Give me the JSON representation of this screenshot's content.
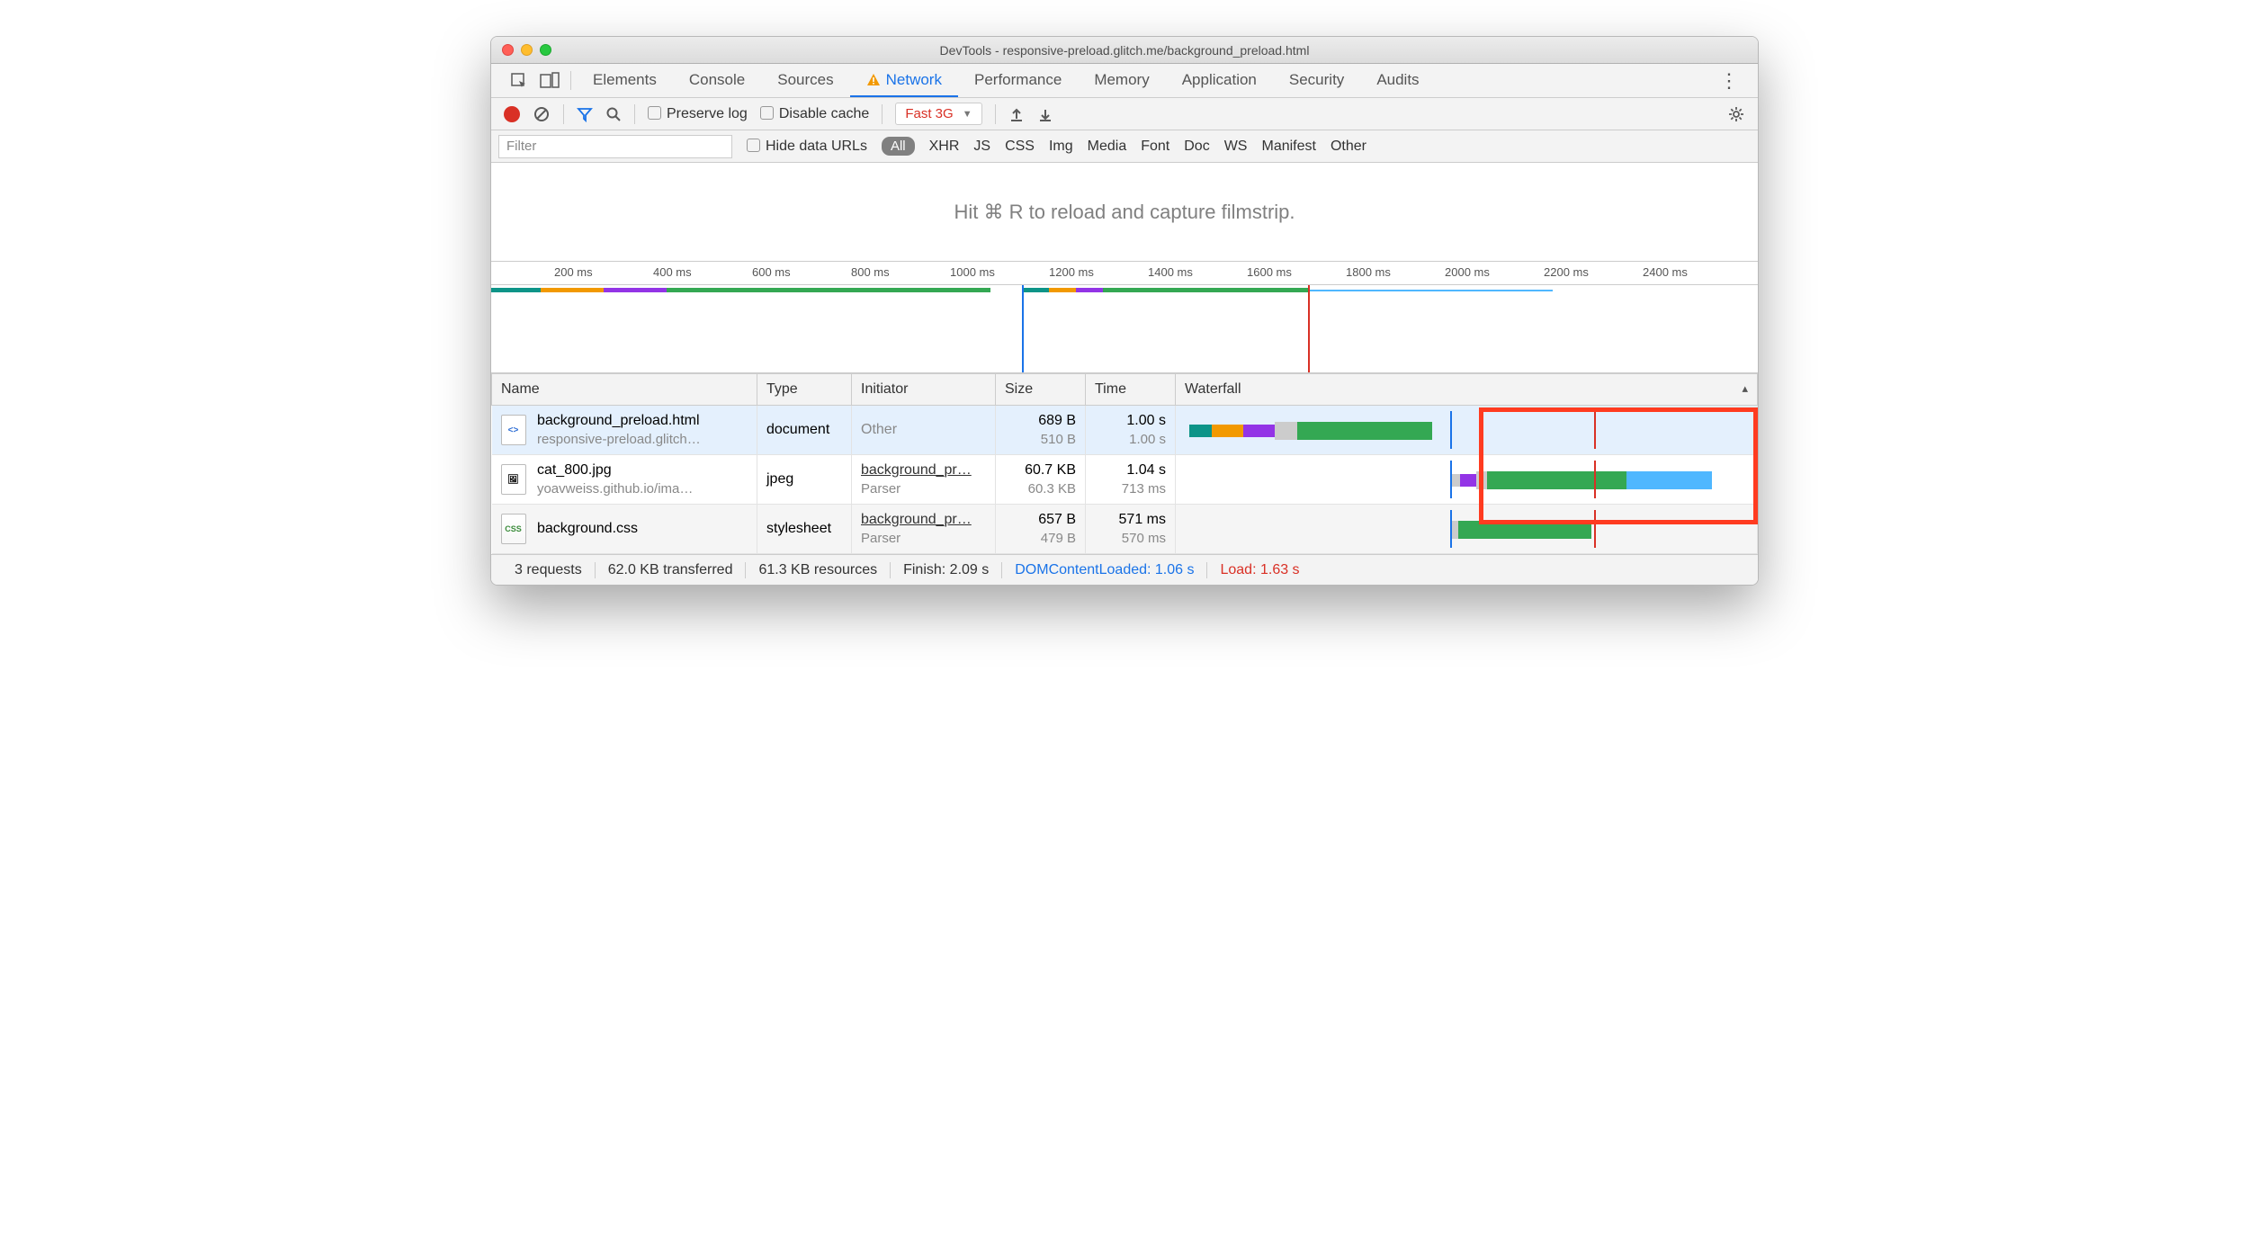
{
  "window": {
    "title": "DevTools - responsive-preload.glitch.me/background_preload.html"
  },
  "panels": [
    "Elements",
    "Console",
    "Sources",
    "Network",
    "Performance",
    "Memory",
    "Application",
    "Security",
    "Audits"
  ],
  "active_panel": "Network",
  "toolbar": {
    "preserve_log": "Preserve log",
    "disable_cache": "Disable cache",
    "throttle": "Fast 3G"
  },
  "filter": {
    "placeholder": "Filter",
    "hide_data_urls": "Hide data URLs",
    "all": "All",
    "types": [
      "XHR",
      "JS",
      "CSS",
      "Img",
      "Media",
      "Font",
      "Doc",
      "WS",
      "Manifest",
      "Other"
    ]
  },
  "filmstrip_hint": "Hit ⌘ R to reload and capture filmstrip.",
  "timeline_ticks": [
    "200 ms",
    "400 ms",
    "600 ms",
    "800 ms",
    "1000 ms",
    "1200 ms",
    "1400 ms",
    "1600 ms",
    "1800 ms",
    "2000 ms",
    "2200 ms",
    "2400 ms"
  ],
  "columns": {
    "name": "Name",
    "type": "Type",
    "initiator": "Initiator",
    "size": "Size",
    "time": "Time",
    "waterfall": "Waterfall"
  },
  "rows": [
    {
      "name": "background_preload.html",
      "sub": "responsive-preload.glitch…",
      "type": "document",
      "initiator": "Other",
      "initiator_sub": "",
      "size": "689 B",
      "size_sub": "510 B",
      "time": "1.00 s",
      "time_sub": "1.00 s"
    },
    {
      "name": "cat_800.jpg",
      "sub": "yoavweiss.github.io/ima…",
      "type": "jpeg",
      "initiator": "background_pr…",
      "initiator_sub": "Parser",
      "size": "60.7 KB",
      "size_sub": "60.3 KB",
      "time": "1.04 s",
      "time_sub": "713 ms"
    },
    {
      "name": "background.css",
      "sub": "",
      "type": "stylesheet",
      "initiator": "background_pr…",
      "initiator_sub": "Parser",
      "size": "657 B",
      "size_sub": "479 B",
      "time": "571 ms",
      "time_sub": "570 ms"
    }
  ],
  "status": {
    "requests": "3 requests",
    "transferred": "62.0 KB transferred",
    "resources": "61.3 KB resources",
    "finish": "Finish: 2.09 s",
    "dcl": "DOMContentLoaded: 1.06 s",
    "load": "Load: 1.63 s"
  }
}
